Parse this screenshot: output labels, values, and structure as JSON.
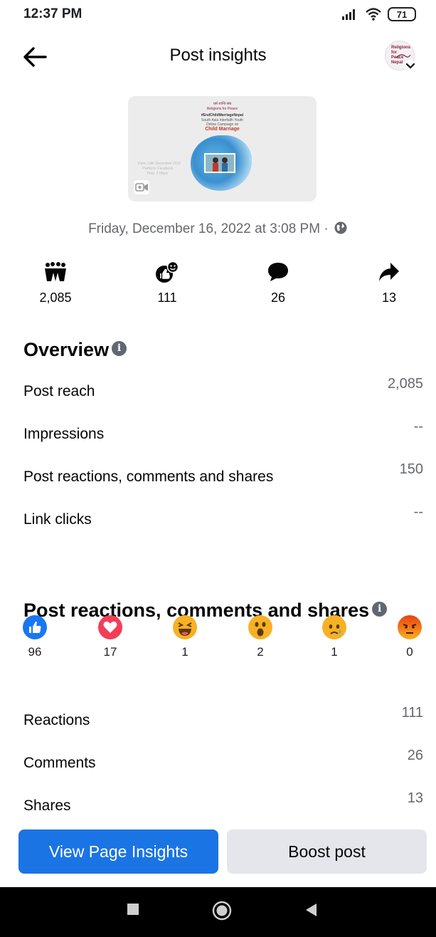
{
  "status_bar": {
    "time": "12:37 PM",
    "battery": "71",
    "icons": [
      "signal-icon",
      "wifi-icon",
      "battery-icon"
    ]
  },
  "header": {
    "title": "Post insights",
    "back_icon": "arrow-left-icon",
    "avatar_label": "Religions for Peace Nepal"
  },
  "post": {
    "thumbnail_lines": [
      "धर्म शान्ति संघ",
      "Religions for Peace",
      "#EndChildMarriageNepal",
      "South Asia Interfaith Youth",
      "Online Campaign on",
      "Child Marriage",
      "Date: 14th December 2022",
      "Platform: Facebook",
      "Time: 2:00pm"
    ],
    "date": "Friday, December 16, 2022 at 3:08 PM ·"
  },
  "metrics": [
    {
      "icon": "people-reached-icon",
      "value": "2,085"
    },
    {
      "icon": "reactions-icon",
      "value": "111"
    },
    {
      "icon": "comment-icon",
      "value": "26"
    },
    {
      "icon": "share-icon",
      "value": "13"
    }
  ],
  "overview": {
    "title": "Overview",
    "rows": [
      {
        "label": "Post reach",
        "value": "2,085"
      },
      {
        "label": "Impressions",
        "value": "--"
      },
      {
        "label": "Post reactions, comments and shares",
        "value": "150"
      },
      {
        "label": "Link clicks",
        "value": "--"
      }
    ]
  },
  "engagement": {
    "title": "Post reactions, comments and shares",
    "reactions": [
      {
        "icon": "like-icon",
        "count": "96",
        "color": "#1877f2"
      },
      {
        "icon": "love-icon",
        "count": "17",
        "color": "#f33e58"
      },
      {
        "icon": "haha-icon",
        "count": "1",
        "color": "#f7b125"
      },
      {
        "icon": "wow-icon",
        "count": "2",
        "color": "#f7b125"
      },
      {
        "icon": "sad-icon",
        "count": "1",
        "color": "#f7b125"
      },
      {
        "icon": "angry-icon",
        "count": "0",
        "color": "#e9710f"
      }
    ],
    "rows": [
      {
        "label": "Reactions",
        "value": "111"
      },
      {
        "label": "Comments",
        "value": "26"
      },
      {
        "label": "Shares",
        "value": "13"
      }
    ]
  },
  "actions": {
    "primary": "View Page Insights",
    "secondary": "Boost post"
  },
  "nav_bar": {
    "buttons": [
      "recents-icon",
      "home-icon",
      "back-icon"
    ]
  },
  "colors": {
    "accent": "#1b74e4",
    "secondary_button": "#e4e6eb",
    "muted_text": "#65676b"
  }
}
